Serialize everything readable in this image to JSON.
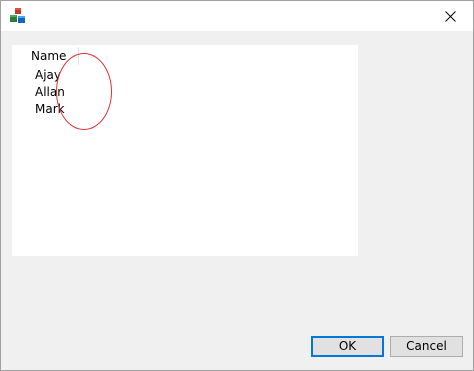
{
  "titlebar": {
    "title": "",
    "icon": "app-cubes-icon",
    "close_icon": "close-icon"
  },
  "list": {
    "columns": [
      {
        "label": "Name"
      }
    ],
    "rows": [
      {
        "name": "Ajay"
      },
      {
        "name": "Allan"
      },
      {
        "name": "Mark"
      }
    ]
  },
  "buttons": {
    "ok_label": "OK",
    "cancel_label": "Cancel"
  },
  "colors": {
    "accent": "#0078d7",
    "annotation": "#e0303a",
    "dialog_bg": "#f0f0f0",
    "list_bg": "#ffffff"
  }
}
